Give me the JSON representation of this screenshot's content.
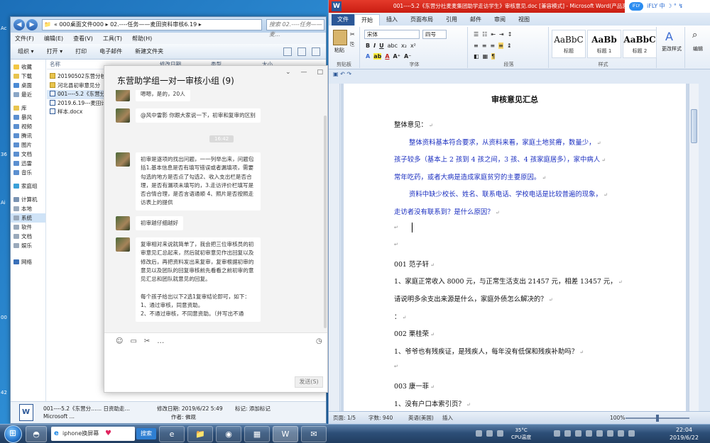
{
  "desktop": {
    "edge_labels": [
      "Ac",
      "36",
      "Ai",
      "00",
      "42"
    ]
  },
  "explorer": {
    "address": "« 000桌面文件000 ▸ 02.----任务——麦田资料审核6.19 ▸",
    "search_placeholder": "搜索 02.----任务——麦...",
    "menu": [
      "文件(F)",
      "编辑(E)",
      "查看(V)",
      "工具(T)",
      "帮助(H)"
    ],
    "toolbar": [
      "组织 ▾",
      "打开 ▾",
      "打印",
      "电子邮件",
      "新建文件夹"
    ],
    "sidebar": [
      "收藏",
      "下载",
      "桌面",
      "最近",
      "库",
      "暴风",
      "视频",
      "腾讯",
      "图片",
      "文档",
      "迅雷",
      "音乐",
      "家庭组",
      "计算机",
      "本地",
      "系统",
      "软件",
      "文档",
      "娱乐",
      "网络"
    ],
    "columns": {
      "name": "名称",
      "date": "修改日期",
      "type": "类型",
      "size": "大小"
    },
    "files": [
      {
        "name": "20190502东营分校",
        "kind": "folder"
      },
      {
        "name": "河北县初审意见分",
        "kind": "folder"
      },
      {
        "name": "001----5.2《东营分",
        "kind": "doc"
      },
      {
        "name": "2019.6.19---麦田计划",
        "kind": "doc"
      },
      {
        "name": "样本.docx",
        "kind": "doc"
      }
    ],
    "details": {
      "filename": "001----5.2《东营分……  日资助走…",
      "modified": "修改日期: 2019/6/22 5:49",
      "tags": "标记: 添加标记",
      "app": "Microsoft …",
      "author": "作者: 佛观"
    }
  },
  "chat": {
    "title": "东营助学组一对一审核小组 (9)",
    "controls": [
      "⌄",
      "—",
      "□"
    ],
    "messages": [
      {
        "text": "嗯嗯，是的，20人"
      },
      {
        "text": "@风中雷影 你跟大家说一下，初审和复审的区别"
      },
      {
        "text": "初审是逐项的找出问题，一一列举出来，问题包括1.基本信息是否有填写错误或者漏填项，需要勾选的地方是否点了勾选2、收入支出栏是否合理，是否有漏项未填写的，3.走访评价栏填写是否合情合理，是否言语通顺 4、照片是否按照走访表上的提供"
      },
      {
        "text": "初审越仔细越好"
      },
      {
        "text": "复审相对来说就简单了，我会把三位审核员的初审意见汇总起来，然后就初审意见作出回复以及修改后，再把资料发出来复审，复审根据初审的意见以及团队的回复审核前先看看之前初审的意见汇总和团队就意见的回复。\n\n每个孩子给出以下2选1复审结论即可，如下：\n1、通过审核，同意资助。\n2、不通过审核，不同意资助。（并写出不通"
      }
    ],
    "timestamp": "16:42",
    "tools": [
      "☺",
      "▭",
      "✂",
      "…"
    ],
    "send_label": "发送(S)"
  },
  "word": {
    "title": "001----5.2《东营分社麦麦集团助学走访学生》审核意见.doc [兼容模式] - Microsoft Word(产品激活失败)",
    "ifly_label": "iFLY 中 ☽ ° ↯",
    "tabs": [
      "文件",
      "开始",
      "插入",
      "页面布局",
      "引用",
      "邮件",
      "审阅",
      "视图"
    ],
    "active_tab": "开始",
    "ribbon": {
      "paste": "粘贴",
      "clipboard": "剪贴板",
      "font_name": "宋体",
      "font_size": "四号",
      "font_group": "字体",
      "para_group": "段落",
      "style_group": "样式",
      "styles": [
        {
          "sample": "AaBbC",
          "label": "标题"
        },
        {
          "sample": "AaBb",
          "label": "标题 1"
        },
        {
          "sample": "AaBbC",
          "label": "标题 2"
        }
      ],
      "change_styles": "更改样式",
      "edit": "编辑"
    },
    "doc": {
      "title": "审核意见汇总",
      "lines": [
        {
          "text": "整体意见：",
          "blue": false
        },
        {
          "text": "整体资料基本符合要求，从资料来看，家庭土地贫瘠，数量少，",
          "blue": true,
          "indent": true
        },
        {
          "text": "孩子较多（基本上 2 孩到 4 孩之间，3 孩、4 孩家庭居多），家中病人",
          "blue": true
        },
        {
          "text": "常年吃药，或者大病是造成家庭贫穷的主要原因。",
          "blue": true
        },
        {
          "text": "资料中缺少校长、姓名、联系电话、学校电话是比较普遍的现象，",
          "blue": true,
          "indent": true
        },
        {
          "text": "走访者没有联系到？是什么原因？",
          "blue": true
        },
        {
          "text": "",
          "blue": false
        },
        {
          "text": "",
          "blue": false
        },
        {
          "text": "001 范子轩",
          "blue": false
        },
        {
          "text": "1、家庭正常收入 8000 元，与正常生活支出 21457 元，相差 13457 元，",
          "blue": false
        },
        {
          "text": "请说明多余支出来源是什么，家庭外债怎么解决的？",
          "blue": false
        },
        {
          "text": "：",
          "blue": false
        },
        {
          "text": "002 栗桂荣",
          "blue": false
        },
        {
          "text": "1、爷爷也有残疾证，是残疾人，每年没有低保和残疾补助吗？",
          "blue": false
        },
        {
          "text": "",
          "blue": false
        },
        {
          "text": "003 康一菲",
          "blue": false
        },
        {
          "text": "1、没有户口本索引页？",
          "blue": false
        }
      ]
    },
    "status": {
      "page": "页面: 1/5",
      "words": "字数: 940",
      "lang": "英语(美国)",
      "mode": "插入",
      "zoom": "100%",
      "zoom_value": 100
    }
  },
  "taskbar": {
    "ie_text": "iphone换屏幕",
    "ie_search": "搜索",
    "weather": "35°C\nCPU温度",
    "time": "22:04",
    "date": "2019/6/22",
    "icons": [
      "e",
      "📁",
      "◉",
      "▦",
      "W",
      "✉"
    ]
  },
  "colors": {
    "word_title": "#e53a2b",
    "link_blue": "#1b2fc0",
    "taskbar": "#2d4f78"
  }
}
